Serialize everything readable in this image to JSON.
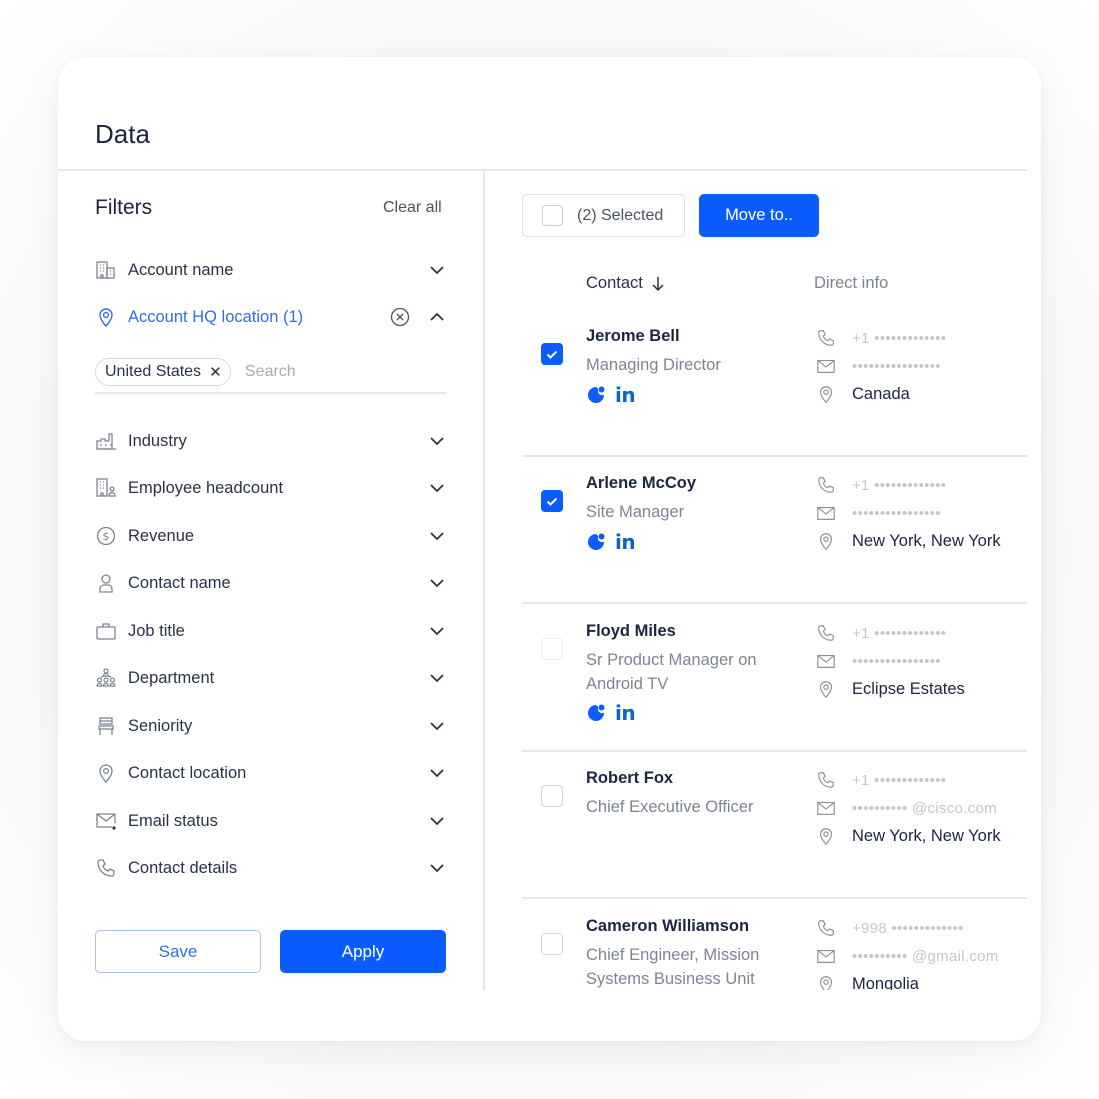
{
  "page": {
    "title": "Data"
  },
  "colors": {
    "accent": "#0b5cff",
    "active_filter": "#2f6fe0",
    "linkedin": "#0a66c2"
  },
  "filters": {
    "title": "Filters",
    "clear_all": "Clear all",
    "items": [
      {
        "label": "Account name",
        "icon": "building-icon",
        "expanded": false
      },
      {
        "label": "Account HQ location (1)",
        "icon": "location-pin-icon",
        "expanded": true,
        "active": true
      },
      {
        "label": "Industry",
        "icon": "factory-icon",
        "expanded": false
      },
      {
        "label": "Employee headcount",
        "icon": "building-people-icon",
        "expanded": false
      },
      {
        "label": "Revenue",
        "icon": "dollar-circle-icon",
        "expanded": false
      },
      {
        "label": "Contact name",
        "icon": "person-icon",
        "expanded": false
      },
      {
        "label": "Job title",
        "icon": "briefcase-icon",
        "expanded": false
      },
      {
        "label": "Department",
        "icon": "org-chart-icon",
        "expanded": false
      },
      {
        "label": "Seniority",
        "icon": "seniority-icon",
        "expanded": false
      },
      {
        "label": "Contact location",
        "icon": "location-pin-icon",
        "expanded": false
      },
      {
        "label": "Email status",
        "icon": "email-status-icon",
        "expanded": false
      },
      {
        "label": "Contact details",
        "icon": "phone-icon",
        "expanded": false
      }
    ],
    "hq_location": {
      "chips": [
        "United States"
      ],
      "search_placeholder": "Search",
      "search_value": ""
    },
    "save_label": "Save",
    "apply_label": "Apply"
  },
  "results": {
    "selected_label": "(2) Selected",
    "move_label": "Move to..",
    "columns": {
      "contact": "Contact",
      "direct_info": "Direct info"
    },
    "contacts": [
      {
        "name": "Jerome Bell",
        "title": "Managing Director",
        "checked": true,
        "socials": true,
        "phone": "+1 •••••••••••••",
        "email": "••••••••••••••••",
        "location": "Canada"
      },
      {
        "name": "Arlene McCoy",
        "title": "Site Manager",
        "checked": true,
        "socials": true,
        "phone": "+1 •••••••••••••",
        "email": "••••••••••••••••",
        "location": "New York, New York"
      },
      {
        "name": "Floyd Miles",
        "title": "Sr Product Manager on Android TV",
        "checked": false,
        "socials": true,
        "phone": "+1 •••••••••••••",
        "email": "••••••••••••••••",
        "location": "Eclipse Estates"
      },
      {
        "name": "Robert Fox",
        "title": "Chief Executive Officer",
        "checked": false,
        "socials": false,
        "phone": "+1 •••••••••••••",
        "email": "•••••••••• @cisco.com",
        "location": "New York, New York"
      },
      {
        "name": "Cameron Williamson",
        "title": "Chief Engineer, Mission Systems Business Unit",
        "checked": false,
        "socials": false,
        "phone": "+998 •••••••••••••",
        "email": "•••••••••• @gmail.com",
        "location": "Mongolia"
      }
    ]
  }
}
